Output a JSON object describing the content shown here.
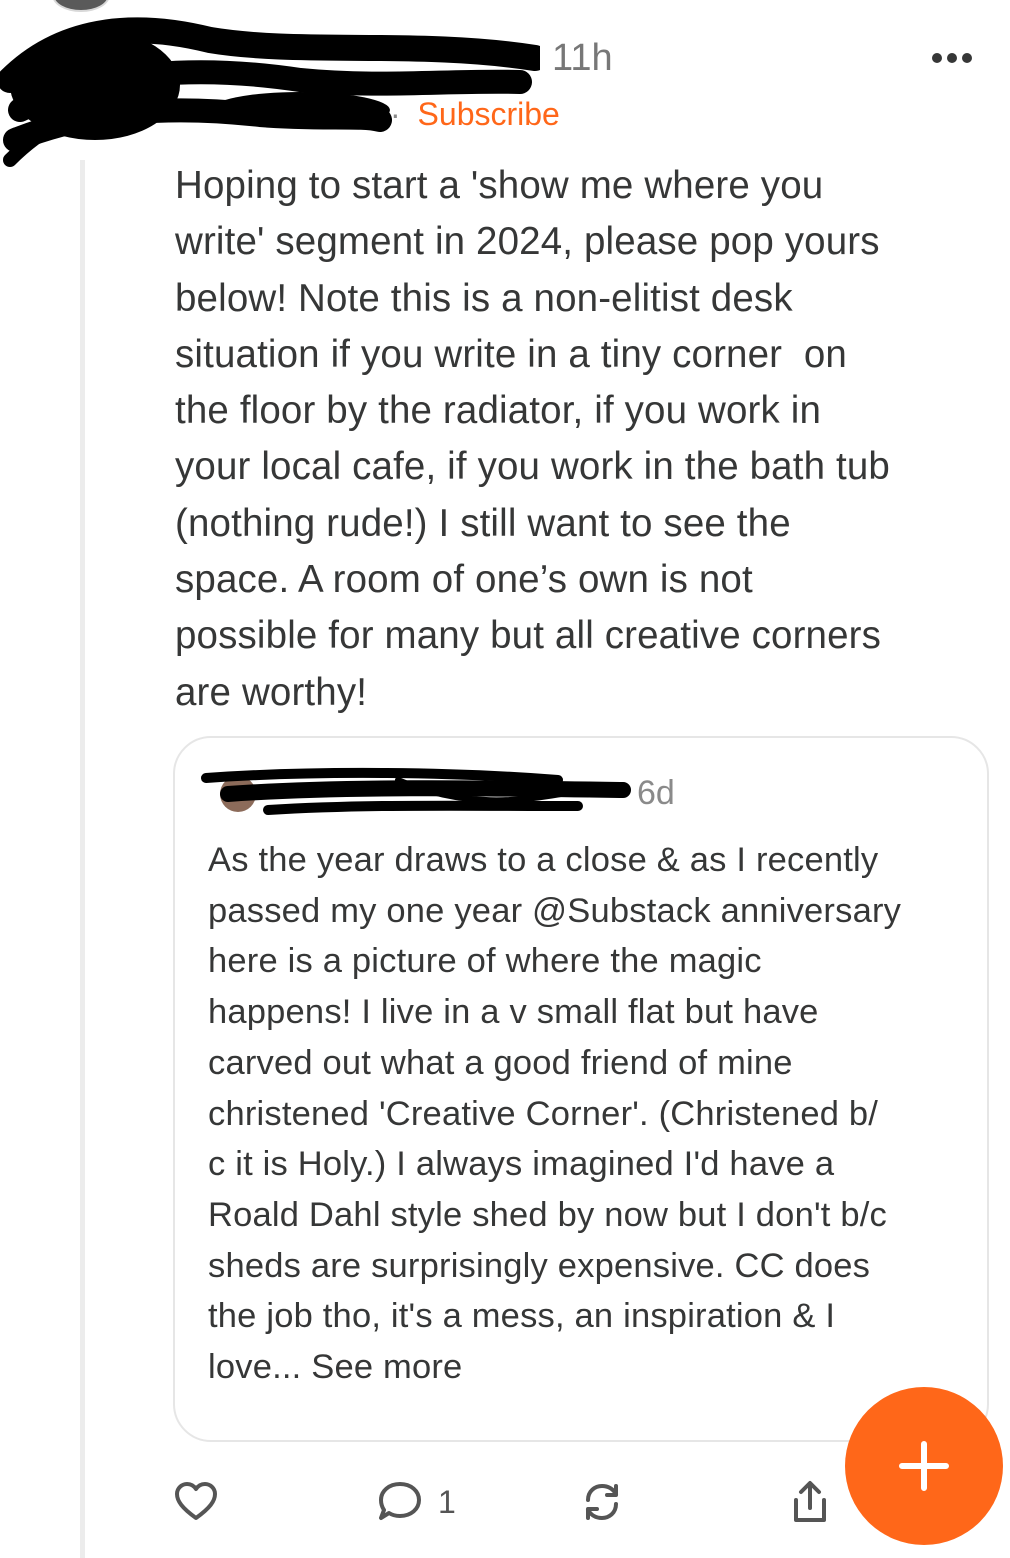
{
  "post": {
    "time": "11h",
    "separator": "·",
    "subscribe_label": "Subscribe",
    "body_lines": [
      "Hoping to start a 'show me where you",
      "write' segment in 2024, please pop yours",
      "below! Note this is a non-elitist desk",
      "situation if you write in a tiny corner  on",
      "the floor by the radiator, if you work in",
      "your local cafe, if you work in the bath tub",
      "(nothing rude!) I still want to see the",
      "space. A room of one’s own is not",
      "possible for many but all creative corners",
      "are worthy!"
    ]
  },
  "quote": {
    "time": "6d",
    "body_lines": [
      "As the year draws to a close & as I recently",
      "passed my one year @Substack anniversary",
      "here is a picture of where the magic",
      "happens! I live in a v small flat but have",
      "carved out what a good friend of mine",
      "christened 'Creative Corner'. (Christened b/",
      "c it is Holy.) I always imagined I'd have a",
      "Roald Dahl style shed by now but I don't b/c",
      "sheds are surprisingly expensive. CC does",
      "the job tho, it's a mess, an inspiration & I"
    ],
    "last_line_prefix": "love...",
    "see_more_label": "See more"
  },
  "actions": {
    "like_icon": "heart-icon",
    "comment_icon": "speech-bubble-icon",
    "comment_count": "1",
    "restack_icon": "restack-icon",
    "share_icon": "share-icon",
    "compose_icon": "plus-icon"
  },
  "colors": {
    "accent": "#ff6719",
    "text": "#363737",
    "muted": "#8a8a8a",
    "border": "#e6e6e6"
  }
}
